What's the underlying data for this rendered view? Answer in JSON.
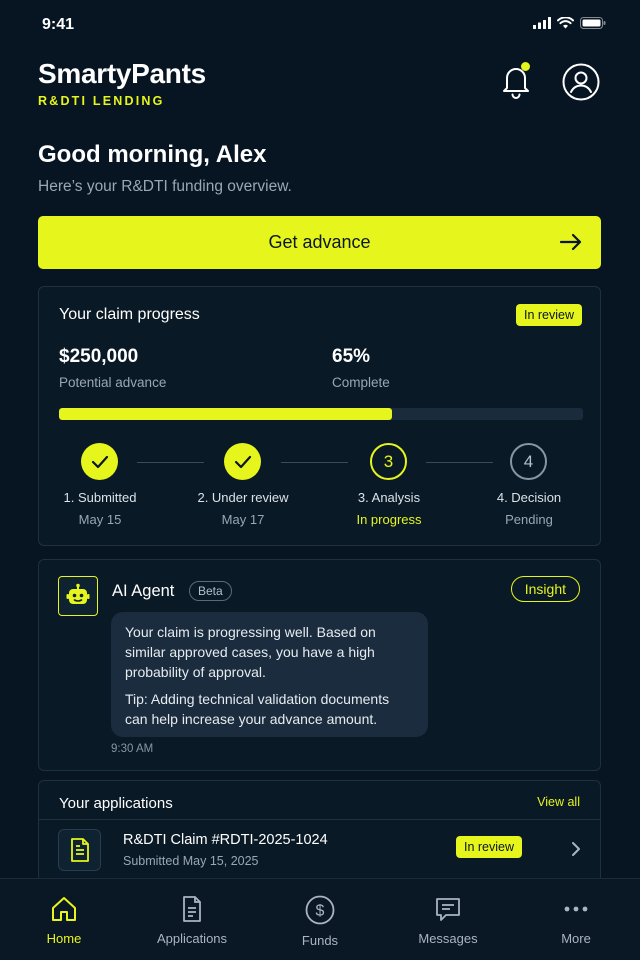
{
  "status_bar": {
    "time": "9:41"
  },
  "header": {
    "brand": "SmartyPants",
    "subtitle": "R&DTI LENDING"
  },
  "greeting": {
    "title": "Good morning, Alex",
    "subtitle": "Here’s your R&DTI funding overview."
  },
  "cta": {
    "label": "Get advance"
  },
  "progress": {
    "title": "Your claim progress",
    "badge": "In review",
    "amount": "$250,000",
    "amount_label": "Potential advance",
    "percent_text": "65%",
    "percent_label": "Complete",
    "percent_value": 0.635,
    "steps": [
      {
        "label": "1. Submitted",
        "date": "May 15",
        "status": "done"
      },
      {
        "label": "2. Under review",
        "date": "May 17",
        "status": "done"
      },
      {
        "label": "3. Analysis",
        "date": "In progress",
        "status": "active",
        "number": "3"
      },
      {
        "label": "4. Decision",
        "date": "Pending",
        "status": "pending",
        "number": "4"
      }
    ]
  },
  "ai_agent": {
    "title": "AI Agent",
    "beta": "Beta",
    "insight": "Insight",
    "message": "Your claim is progressing well. Based on similar approved cases, you have a high probability of approval.",
    "tip": "Tip: Adding technical validation documents can help increase your advance amount.",
    "time": "9:30 AM"
  },
  "applications": {
    "title": "Your applications",
    "view_all": "View all",
    "items": [
      {
        "name": "R&DTI Claim #RDTI-2025-1024",
        "submitted": "Submitted May 15, 2025",
        "status": "In review"
      }
    ]
  },
  "nav": {
    "items": [
      {
        "label": "Home",
        "icon": "home-icon",
        "active": true
      },
      {
        "label": "Applications",
        "icon": "document-icon",
        "active": false
      },
      {
        "label": "Funds",
        "icon": "dollar-icon",
        "active": false
      },
      {
        "label": "Messages",
        "icon": "message-icon",
        "active": false
      },
      {
        "label": "More",
        "icon": "more-icon",
        "active": false
      }
    ]
  },
  "colors": {
    "accent": "#e6f51c",
    "background": "#071522",
    "card": "#0a1926"
  }
}
